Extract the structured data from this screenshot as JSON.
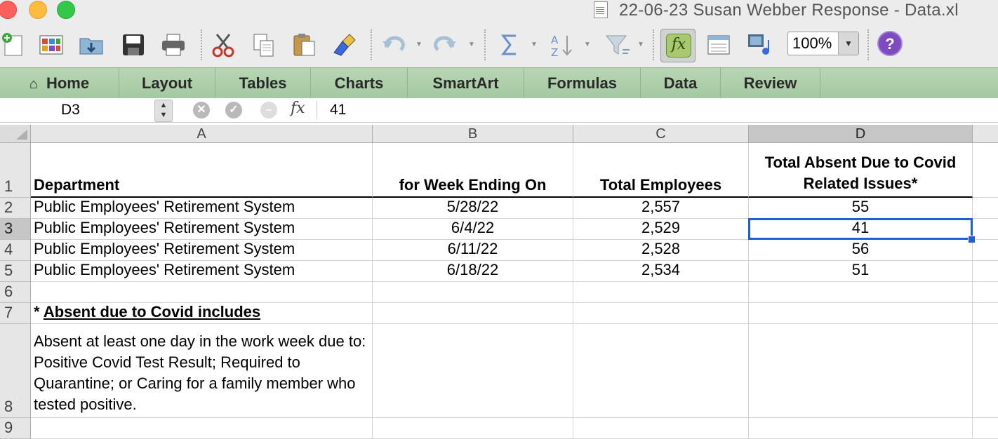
{
  "window": {
    "title": "22-06-23 Susan Webber Response - Data.xl"
  },
  "toolbar": {
    "buttons": [
      {
        "name": "new-workbook",
        "icon": "new-doc-icon"
      },
      {
        "name": "templates",
        "icon": "gallery-icon"
      },
      {
        "name": "open",
        "icon": "open-folder-icon"
      },
      {
        "name": "save",
        "icon": "save-icon"
      },
      {
        "name": "print",
        "icon": "print-icon"
      },
      {
        "name": "cut",
        "icon": "scissors-icon"
      },
      {
        "name": "copy",
        "icon": "copy-icon"
      },
      {
        "name": "paste",
        "icon": "paste-icon"
      },
      {
        "name": "format-painter",
        "icon": "brush-icon"
      },
      {
        "name": "undo",
        "icon": "undo-icon"
      },
      {
        "name": "redo",
        "icon": "redo-icon"
      },
      {
        "name": "autosum",
        "icon": "sigma-icon"
      },
      {
        "name": "sort",
        "icon": "sort-icon"
      },
      {
        "name": "filter",
        "icon": "filter-icon"
      },
      {
        "name": "formula-builder",
        "icon": "fx-icon"
      },
      {
        "name": "show-hide",
        "icon": "sidebar-icon"
      },
      {
        "name": "media-browser",
        "icon": "media-icon"
      },
      {
        "name": "help",
        "icon": "help-icon"
      }
    ],
    "fx_label": "fx",
    "zoom": "100%",
    "help_label": "?"
  },
  "ribbon": {
    "tabs": [
      "Home",
      "Layout",
      "Tables",
      "Charts",
      "SmartArt",
      "Formulas",
      "Data",
      "Review"
    ]
  },
  "formula_bar": {
    "name_box": "D3",
    "fx_label": "fx",
    "value": "41"
  },
  "sheet": {
    "columns": [
      "A",
      "B",
      "C",
      "D"
    ],
    "rows": [
      "1",
      "2",
      "3",
      "4",
      "5",
      "6",
      "7",
      "8",
      "9"
    ],
    "selected_cell": "D3",
    "header": {
      "department": "Department",
      "week_ending": "for Week Ending On",
      "total_employees": "Total Employees",
      "total_absent": "Total Absent Due to Covid Related Issues*"
    },
    "data_rows": [
      {
        "department": "Public Employees' Retirement System",
        "week_ending": "5/28/22",
        "total_employees": "2,557",
        "total_absent": "55"
      },
      {
        "department": "Public Employees' Retirement System",
        "week_ending": "6/4/22",
        "total_employees": "2,529",
        "total_absent": "41"
      },
      {
        "department": "Public Employees' Retirement System",
        "week_ending": "6/11/22",
        "total_employees": "2,528",
        "total_absent": "56"
      },
      {
        "department": "Public Employees' Retirement System",
        "week_ending": "6/18/22",
        "total_employees": "2,534",
        "total_absent": "51"
      }
    ],
    "footnote_star": "* ",
    "footnote_title": "Absent due to Covid includes",
    "footnote_body": "Absent at least one day in the work week due to: Positive Covid Test Result; Required to Quarantine; or Caring for a family member who tested positive."
  },
  "colors": {
    "ribbon": "#a4c8a0",
    "selection": "#1c5fd6",
    "help": "#7d4bbf"
  }
}
